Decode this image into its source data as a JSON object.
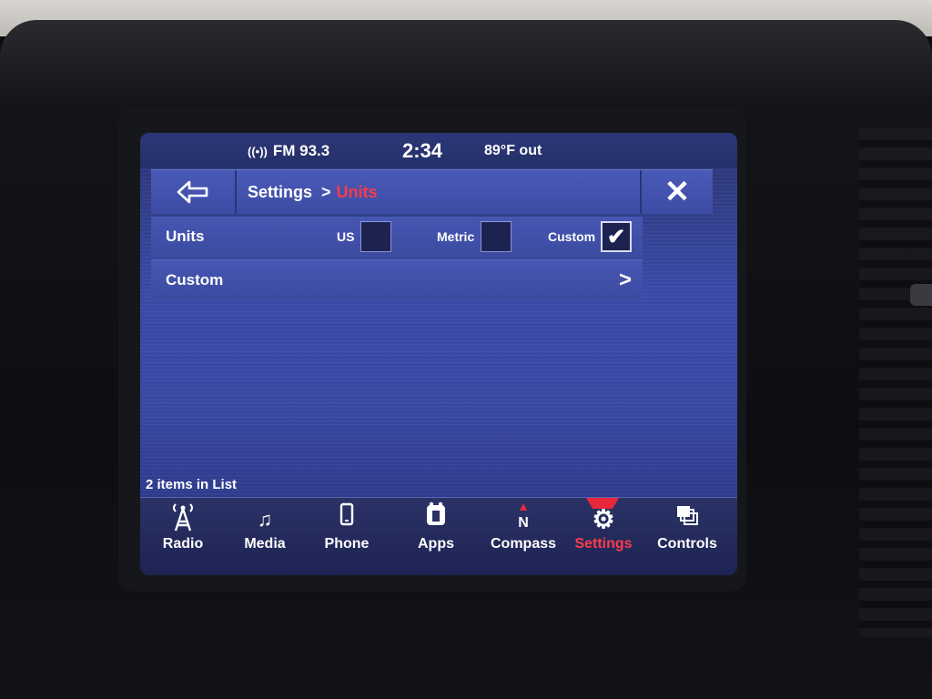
{
  "status": {
    "radio_icon": "antenna-signal-icon",
    "radio": "FM 93.3",
    "time": "2:34",
    "temperature": "89°F out"
  },
  "header": {
    "back_icon": "back-arrow-icon",
    "breadcrumb_parent": "Settings",
    "breadcrumb_separator": ">",
    "breadcrumb_current": "Units",
    "close_icon": "close-icon",
    "active_color": "#ff3b4a"
  },
  "units_row": {
    "label": "Units",
    "options": [
      {
        "label": "US",
        "checked": false
      },
      {
        "label": "Metric",
        "checked": false
      },
      {
        "label": "Custom",
        "checked": true
      }
    ]
  },
  "custom_row": {
    "label": "Custom",
    "chevron": ">"
  },
  "list_count": "2 items in List",
  "nav": [
    {
      "label": "Radio",
      "icon": "radio-tower-icon",
      "glyph": "📡"
    },
    {
      "label": "Media",
      "icon": "music-note-icon",
      "glyph": "♫"
    },
    {
      "label": "Phone",
      "icon": "phone-icon",
      "glyph": "▯"
    },
    {
      "label": "Apps",
      "icon": "apps-icon",
      "glyph": "Ü"
    },
    {
      "label": "Compass",
      "icon": "compass-icon",
      "glyph": "N"
    },
    {
      "label": "Settings",
      "icon": "gear-icon",
      "glyph": "⚙",
      "active": true
    },
    {
      "label": "Controls",
      "icon": "controls-icon",
      "glyph": "❐"
    }
  ]
}
